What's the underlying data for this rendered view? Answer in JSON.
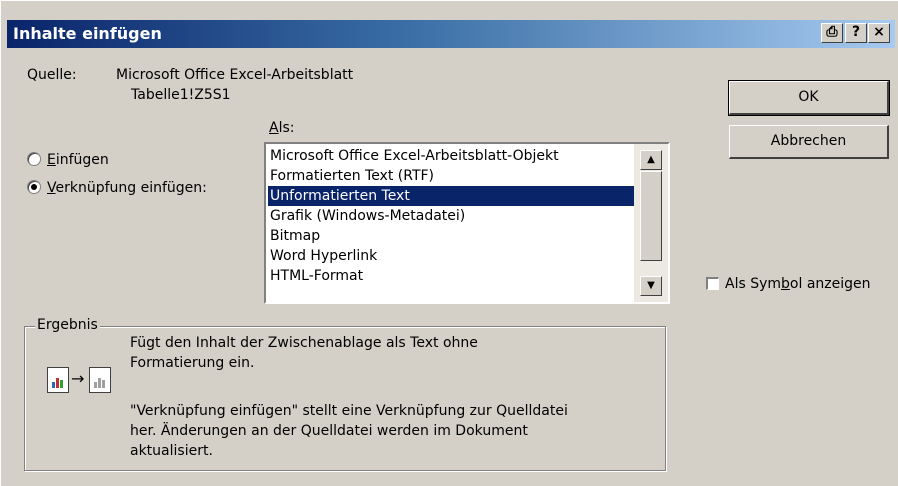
{
  "window": {
    "title": "Inhalte einfügen",
    "print_glyph": "⎙",
    "help_glyph": "?",
    "close_glyph": "×"
  },
  "source": {
    "label": "Quelle:",
    "line1": "Microsoft Office Excel-Arbeitsblatt",
    "line2": "Tabelle1!Z5S1"
  },
  "as_label": "Als:",
  "options": {
    "insert": "Einfügen",
    "insert_link": "Verknüpfung einfügen:",
    "selected": "insert_link"
  },
  "list": {
    "items": [
      "Microsoft Office Excel-Arbeitsblatt-Objekt",
      "Formatierten Text (RTF)",
      "Unformatierten Text",
      "Grafik (Windows-Metadatei)",
      "Bitmap",
      "Word Hyperlink",
      "HTML-Format"
    ],
    "selected_index": 2
  },
  "buttons": {
    "ok": "OK",
    "cancel": "Abbrechen"
  },
  "show_as_icon": {
    "label": "Als Symbol anzeigen",
    "checked": false
  },
  "result": {
    "legend": "Ergebnis",
    "line1": "Fügt den Inhalt der Zwischenablage als Text ohne",
    "line2": "Formatierung ein.",
    "line3": "\"Verknüpfung einfügen\" stellt eine Verknüpfung zur Quelldatei",
    "line4": "her. Änderungen an der Quelldatei werden im Dokument",
    "line5": "aktualisiert."
  },
  "colors": {
    "selection": "#0a246a",
    "dialog_bg": "#d4d0c8"
  }
}
